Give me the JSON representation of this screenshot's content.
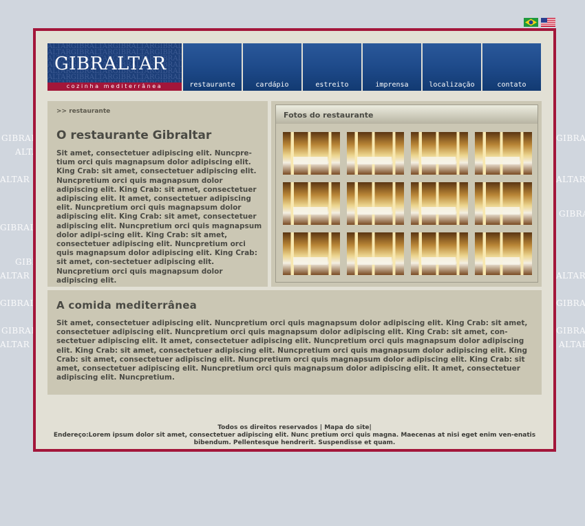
{
  "watermark": {
    "text_full": "GIBRALTAR",
    "text_partial": "ALTAR"
  },
  "flags": {
    "portuguese": "brazil-flag-icon",
    "english": "us-flag-icon"
  },
  "logo": {
    "title": "GIBRALTAR",
    "subtitle": "cozinha mediterrânea",
    "bg_text": "ALTARGIBRALTARGIBRALTARGIBRALTAR"
  },
  "nav": {
    "items": [
      {
        "label": "restaurante"
      },
      {
        "label": "cardápio"
      },
      {
        "label": "estreito"
      },
      {
        "label": "imprensa"
      },
      {
        "label": "localização"
      },
      {
        "label": "contato"
      }
    ]
  },
  "breadcrumb": ">> restaurante",
  "intro": {
    "title": "O restaurante Gibraltar",
    "text": "Sit amet, consectetuer adipiscing elit. Nuncpre-tium orci quis magnapsum dolor adipiscing elit. King Crab: sit amet, consectetuer adipiscing elit. Nuncpretium orci quis magnapsum dolor adipiscing elit. King Crab: sit amet, consectetuer adipiscing elit. It amet, consectetuer adipiscing elit. Nuncpretium orci quis magnapsum dolor adipiscing elit. King Crab: sit amet, consectetuer adipiscing elit. Nuncpretium orci quis magnapsum dolor adipi-scing elit. King Crab: sit amet, consectetuer adipiscing elit. Nuncpretium orci quis magnapsum dolor adipiscing elit. King Crab: sit amet, con-sectetuer adipiscing elit. Nuncpretium orci quis magnapsum dolor adipiscing elit."
  },
  "photos": {
    "title": "Fotos do restaurante",
    "count": 12
  },
  "food": {
    "title": "A comida mediterrânea",
    "text": "Sit amet, consectetuer adipiscing elit. Nuncpretium orci quis magnapsum dolor adipiscing elit. King Crab: sit amet, consectetuer adipiscing elit. Nuncpretium orci quis magnapsum dolor adipiscing elit. King Crab: sit amet, con-sectetuer adipiscing elit. It amet, consectetuer adipiscing elit. Nuncpretium orci quis magnapsum dolor adipiscing elit. King Crab: sit amet, consectetuer adipiscing elit. Nuncpretium orci quis magnapsum dolor adipiscing elit. King Crab: sit amet, consectetuer adipiscing elit. Nuncpretium orci quis magnapsum dolor adipiscing elit. King Crab: sit amet, consectetuer adipiscing elit. Nuncpretium orci quis magnapsum dolor adipiscing elit. It amet, consectetuer adipiscing elit. Nuncpretium."
  },
  "footer": {
    "rights": "Todos os direitos reservados",
    "sep1": " | ",
    "sitemap": "Mapa do site",
    "sep2": "|",
    "address": "Endereço:Lorem ipsum dolor sit amet, consectetuer adipiscing elit. Nunc pretium orci quis magna. Maecenas at nisi eget enim ven-enatis bibendum. Pellentesque hendrerit. Suspendisse et quam."
  },
  "colors": {
    "frame": "#a3163a",
    "nav": "#1e4a8a",
    "panel": "#cbc7b4",
    "background": "#d0d6de"
  }
}
